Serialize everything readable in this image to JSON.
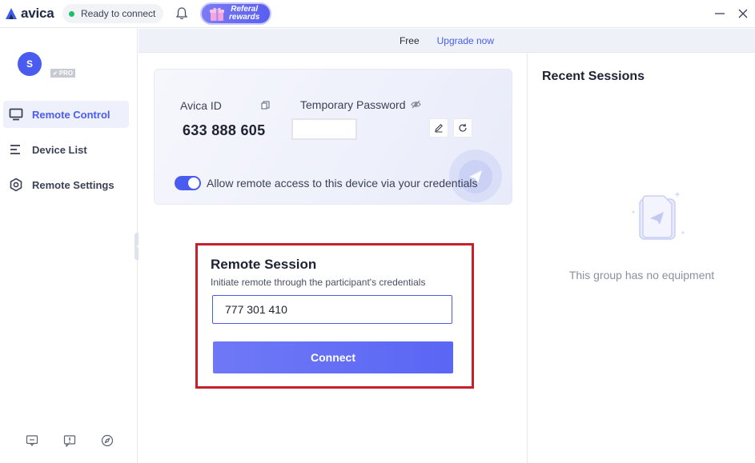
{
  "app": {
    "logo_text": "avica"
  },
  "titlebar": {
    "status": "Ready to connect",
    "status_color": "#1fbf6a",
    "referral_line1": "Referal",
    "referral_line2": "rewards",
    "icons": [
      "avica-logo-icon",
      "bell-icon",
      "gift-icon",
      "minimize-icon",
      "close-icon"
    ]
  },
  "banner": {
    "plan": "Free",
    "upgrade": "Upgrade now"
  },
  "sidebar": {
    "avatar_initial": "S",
    "badge": "PRO",
    "items": [
      {
        "label": "Remote Control",
        "icon": "monitor-icon",
        "active": true
      },
      {
        "label": "Device List",
        "icon": "list-icon",
        "active": false
      },
      {
        "label": "Remote Settings",
        "icon": "settings-hex-icon",
        "active": false
      }
    ],
    "footer_icons": [
      "feedback-icon",
      "report-icon",
      "compass-icon"
    ]
  },
  "device": {
    "id_label": "Avica ID",
    "id_value": "633 888 605",
    "password_label": "Temporary Password",
    "password_value": "",
    "allow_label": "Allow remote access to this device via your credentials",
    "allow_enabled": true
  },
  "session": {
    "title": "Remote Session",
    "subtitle": "Initiate remote through the participant's credentials",
    "input_value": "777 301 410",
    "connect_label": "Connect"
  },
  "recent": {
    "title": "Recent Sessions",
    "empty_text": "This group has no equipment"
  },
  "colors": {
    "accent": "#4a5cf0",
    "highlight_border": "#c8202a"
  }
}
